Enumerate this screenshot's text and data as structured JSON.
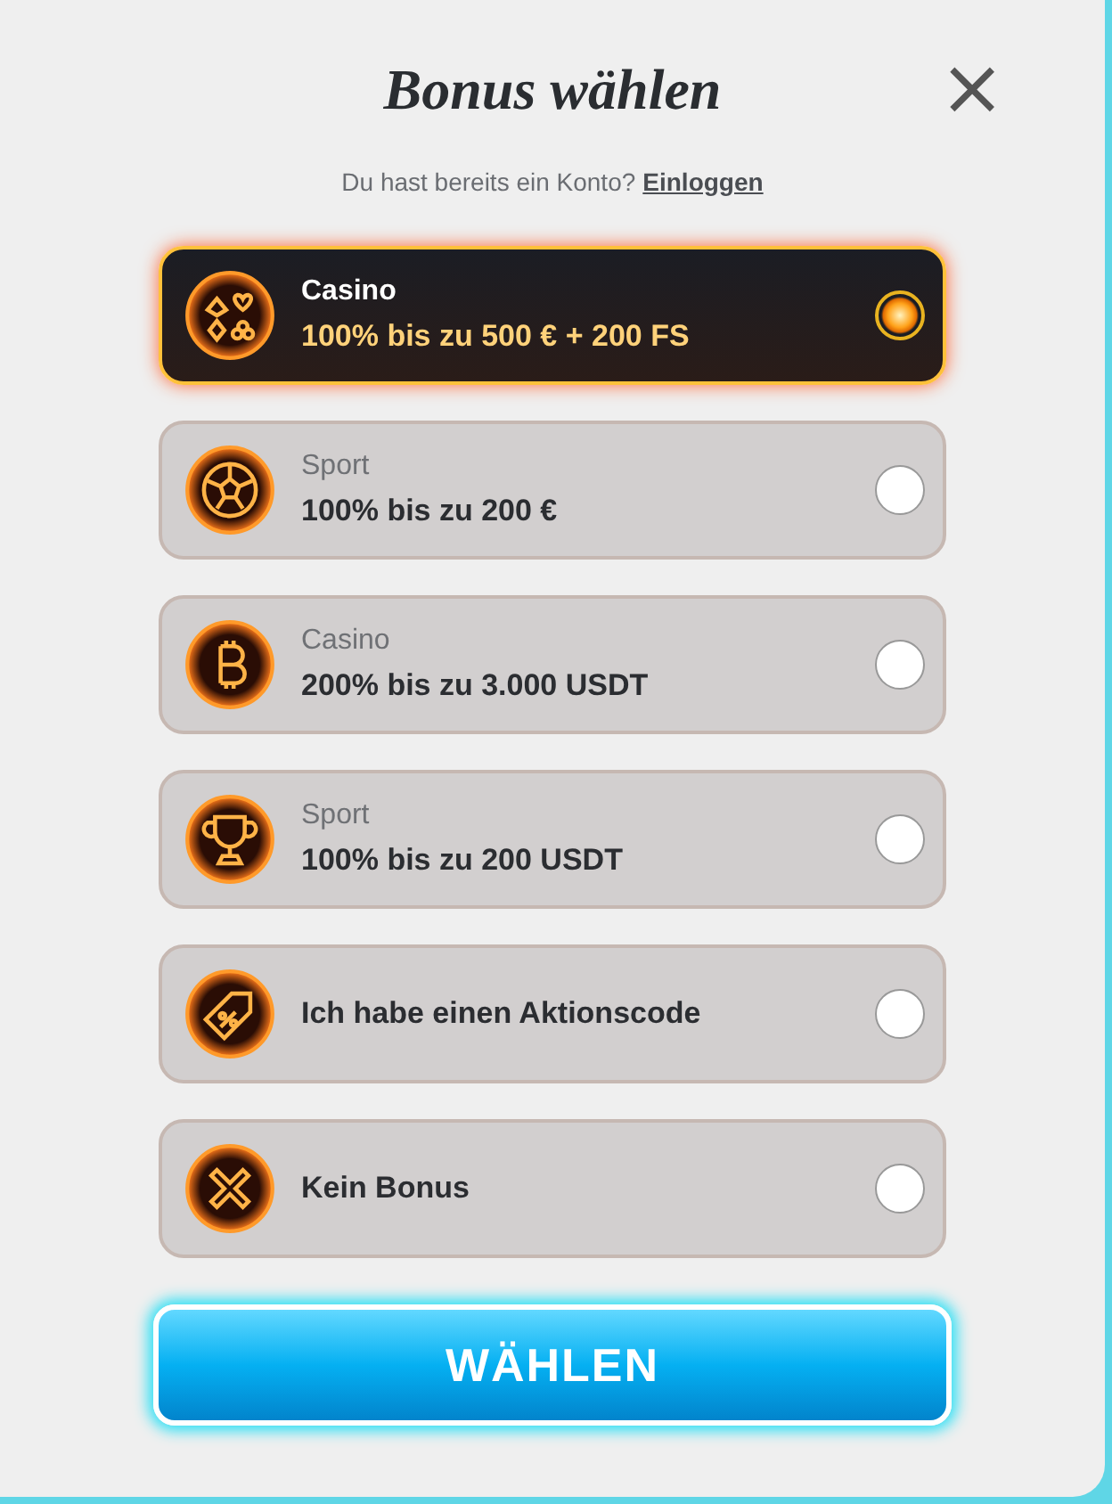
{
  "title": "Bonus wählen",
  "close": "×",
  "login_prompt": {
    "text": "Du hast bereits ein Konto?",
    "link": "Einloggen"
  },
  "options": [
    {
      "kind": "cards",
      "category": "Casino",
      "offer": "100% bis zu 500 € + 200 FS",
      "selected": true
    },
    {
      "kind": "ball",
      "category": "Sport",
      "offer": "100% bis zu 200 €",
      "selected": false
    },
    {
      "kind": "bitcoin",
      "category": "Casino",
      "offer": "200% bis zu 3.000 USDT",
      "selected": false
    },
    {
      "kind": "trophy",
      "category": "Sport",
      "offer": "100% bis zu 200 USDT",
      "selected": false
    },
    {
      "kind": "coupon",
      "offer": "Ich habe einen Aktionscode",
      "selected": false
    },
    {
      "kind": "cross",
      "offer": "Kein Bonus",
      "selected": false
    }
  ],
  "submit": "WÄHLEN"
}
